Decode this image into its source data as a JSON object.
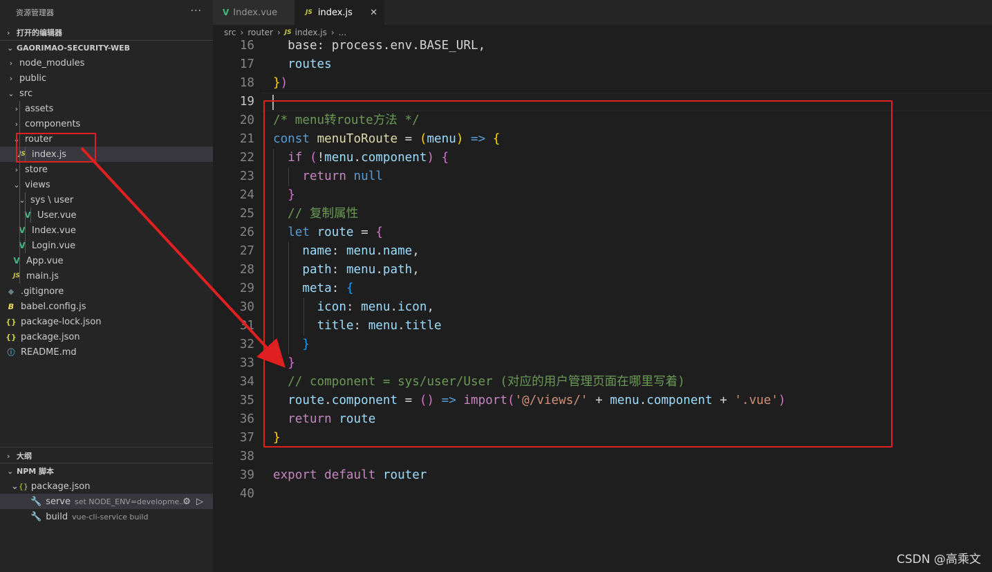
{
  "explorer": {
    "title": "资源管理器",
    "more_label": "···",
    "open_editors": "打开的编辑器",
    "project": "GAORIMAO-SECURITY-WEB",
    "tree": [
      {
        "label": "node_modules",
        "depth": 0,
        "type": "folder",
        "open": false,
        "icon": "chevron-right-icon"
      },
      {
        "label": "public",
        "depth": 0,
        "type": "folder",
        "open": false,
        "icon": "chevron-right-icon"
      },
      {
        "label": "src",
        "depth": 0,
        "type": "folder",
        "open": true,
        "icon": "chevron-down-icon"
      },
      {
        "label": "assets",
        "depth": 1,
        "type": "folder",
        "open": false,
        "icon": "chevron-right-icon"
      },
      {
        "label": "components",
        "depth": 1,
        "type": "folder",
        "open": false,
        "icon": "chevron-right-icon"
      },
      {
        "label": "router",
        "depth": 1,
        "type": "folder",
        "open": true,
        "icon": "chevron-down-icon"
      },
      {
        "label": "index.js",
        "depth": 2,
        "type": "js",
        "selected": true,
        "icon": "js-file-icon"
      },
      {
        "label": "store",
        "depth": 1,
        "type": "folder",
        "open": false,
        "icon": "chevron-right-icon"
      },
      {
        "label": "views",
        "depth": 1,
        "type": "folder",
        "open": true,
        "icon": "chevron-down-icon"
      },
      {
        "label": "sys \\ user",
        "depth": 2,
        "type": "folder",
        "open": true,
        "icon": "chevron-down-icon"
      },
      {
        "label": "User.vue",
        "depth": 3,
        "type": "vue",
        "icon": "vue-file-icon"
      },
      {
        "label": "Index.vue",
        "depth": 2,
        "type": "vue",
        "icon": "vue-file-icon"
      },
      {
        "label": "Login.vue",
        "depth": 2,
        "type": "vue",
        "icon": "vue-file-icon"
      },
      {
        "label": "App.vue",
        "depth": 1,
        "type": "vue",
        "icon": "vue-file-icon"
      },
      {
        "label": "main.js",
        "depth": 1,
        "type": "js",
        "icon": "js-file-icon"
      },
      {
        "label": ".gitignore",
        "depth": 0,
        "type": "git",
        "icon": "git-file-icon"
      },
      {
        "label": "babel.config.js",
        "depth": 0,
        "type": "babel",
        "icon": "babel-file-icon"
      },
      {
        "label": "package-lock.json",
        "depth": 0,
        "type": "json",
        "icon": "json-file-icon"
      },
      {
        "label": "package.json",
        "depth": 0,
        "type": "json",
        "icon": "json-file-icon"
      },
      {
        "label": "README.md",
        "depth": 0,
        "type": "info",
        "icon": "info-file-icon"
      }
    ],
    "outline": "大纲",
    "npm_scripts": "NPM 脚本",
    "npm_package": "package.json",
    "scripts": [
      {
        "name": "serve",
        "cmd": "set NODE_ENV=developme...",
        "selected": true
      },
      {
        "name": "build",
        "cmd": "vue-cli-service build",
        "selected": false
      }
    ]
  },
  "tabs": [
    {
      "label": "Index.vue",
      "icon": "vue-file-icon",
      "active": false
    },
    {
      "label": "index.js",
      "icon": "js-file-icon",
      "active": true,
      "close": "✕"
    }
  ],
  "breadcrumb": [
    "src",
    "router",
    "index.js",
    "..."
  ],
  "icons": {
    "js": "JS",
    "vue": "V",
    "json": "{}",
    "babel": "B",
    "git": "◆",
    "info": "ⓘ",
    "chev_right": "›",
    "chev_down": "⌄"
  },
  "colors": {
    "highlight_box": "#e02020",
    "background": "#1e1e1e",
    "sidebar": "#252526"
  },
  "editor": {
    "current_line": 19,
    "lines": [
      {
        "n": "16",
        "t": [
          [
            "  base: process.env.BASE_URL,",
            "c-p"
          ]
        ]
      },
      {
        "n": "17",
        "t": [
          [
            "  ",
            "c-p"
          ],
          [
            "routes",
            "c-var"
          ]
        ]
      },
      {
        "n": "18",
        "t": [
          [
            "}",
            "c-b1"
          ],
          [
            ")",
            "c-b2"
          ]
        ]
      },
      {
        "n": "19",
        "t": []
      },
      {
        "n": "20",
        "t": [
          [
            "/* menu转route方法 */",
            "c-com"
          ]
        ]
      },
      {
        "n": "21",
        "t": [
          [
            "const ",
            "c-kw"
          ],
          [
            "menuToRoute",
            "c-fn"
          ],
          [
            " = ",
            "c-p"
          ],
          [
            "(",
            "c-b1"
          ],
          [
            "menu",
            "c-var"
          ],
          [
            ")",
            "c-b1"
          ],
          [
            " => ",
            "c-kw"
          ],
          [
            "{",
            "c-b1"
          ]
        ]
      },
      {
        "n": "22",
        "t": [
          [
            "  ",
            "c-p"
          ],
          [
            "if",
            "c-ctl"
          ],
          [
            " ",
            "c-p"
          ],
          [
            "(",
            "c-b2"
          ],
          [
            "!",
            "c-p"
          ],
          [
            "menu",
            "c-var"
          ],
          [
            ".",
            "c-p"
          ],
          [
            "component",
            "c-var"
          ],
          [
            ")",
            "c-b2"
          ],
          [
            " ",
            "c-p"
          ],
          [
            "{",
            "c-b2"
          ]
        ]
      },
      {
        "n": "23",
        "t": [
          [
            "    ",
            "c-p"
          ],
          [
            "return",
            "c-ctl"
          ],
          [
            " ",
            "c-p"
          ],
          [
            "null",
            "c-kw"
          ]
        ]
      },
      {
        "n": "24",
        "t": [
          [
            "  ",
            "c-p"
          ],
          [
            "}",
            "c-b2"
          ]
        ]
      },
      {
        "n": "25",
        "t": [
          [
            "  // 复制属性",
            "c-com"
          ]
        ]
      },
      {
        "n": "26",
        "t": [
          [
            "  ",
            "c-p"
          ],
          [
            "let",
            "c-kw"
          ],
          [
            " ",
            "c-p"
          ],
          [
            "route",
            "c-var"
          ],
          [
            " = ",
            "c-p"
          ],
          [
            "{",
            "c-b2"
          ]
        ]
      },
      {
        "n": "27",
        "t": [
          [
            "    ",
            "c-p"
          ],
          [
            "name",
            "c-var"
          ],
          [
            ": ",
            "c-p"
          ],
          [
            "menu",
            "c-var"
          ],
          [
            ".",
            "c-p"
          ],
          [
            "name",
            "c-var"
          ],
          [
            ",",
            "c-p"
          ]
        ]
      },
      {
        "n": "28",
        "t": [
          [
            "    ",
            "c-p"
          ],
          [
            "path",
            "c-var"
          ],
          [
            ": ",
            "c-p"
          ],
          [
            "menu",
            "c-var"
          ],
          [
            ".",
            "c-p"
          ],
          [
            "path",
            "c-var"
          ],
          [
            ",",
            "c-p"
          ]
        ]
      },
      {
        "n": "29",
        "t": [
          [
            "    ",
            "c-p"
          ],
          [
            "meta",
            "c-var"
          ],
          [
            ": ",
            "c-p"
          ],
          [
            "{",
            "c-b3"
          ]
        ]
      },
      {
        "n": "30",
        "t": [
          [
            "      ",
            "c-p"
          ],
          [
            "icon",
            "c-var"
          ],
          [
            ": ",
            "c-p"
          ],
          [
            "menu",
            "c-var"
          ],
          [
            ".",
            "c-p"
          ],
          [
            "icon",
            "c-var"
          ],
          [
            ",",
            "c-p"
          ]
        ]
      },
      {
        "n": "31",
        "t": [
          [
            "      ",
            "c-p"
          ],
          [
            "title",
            "c-var"
          ],
          [
            ": ",
            "c-p"
          ],
          [
            "menu",
            "c-var"
          ],
          [
            ".",
            "c-p"
          ],
          [
            "title",
            "c-var"
          ]
        ]
      },
      {
        "n": "32",
        "t": [
          [
            "    ",
            "c-p"
          ],
          [
            "}",
            "c-b3"
          ]
        ]
      },
      {
        "n": "33",
        "t": [
          [
            "  ",
            "c-p"
          ],
          [
            "}",
            "c-b2"
          ]
        ]
      },
      {
        "n": "34",
        "t": [
          [
            "  // component = sys/user/User (对应的用户管理页面在哪里写着)",
            "c-com"
          ]
        ]
      },
      {
        "n": "35",
        "t": [
          [
            "  ",
            "c-p"
          ],
          [
            "route",
            "c-var"
          ],
          [
            ".",
            "c-p"
          ],
          [
            "component",
            "c-var"
          ],
          [
            " = ",
            "c-p"
          ],
          [
            "()",
            "c-b2"
          ],
          [
            " => ",
            "c-kw"
          ],
          [
            "import",
            "c-ctl"
          ],
          [
            "(",
            "c-b2"
          ],
          [
            "'@/views/'",
            "c-str"
          ],
          [
            " + ",
            "c-p"
          ],
          [
            "menu",
            "c-var"
          ],
          [
            ".",
            "c-p"
          ],
          [
            "component",
            "c-var"
          ],
          [
            " + ",
            "c-p"
          ],
          [
            "'.vue'",
            "c-str"
          ],
          [
            ")",
            "c-b2"
          ]
        ]
      },
      {
        "n": "36",
        "t": [
          [
            "  ",
            "c-p"
          ],
          [
            "return",
            "c-ctl"
          ],
          [
            " ",
            "c-p"
          ],
          [
            "route",
            "c-var"
          ]
        ]
      },
      {
        "n": "37",
        "t": [
          [
            "}",
            "c-b1"
          ]
        ]
      },
      {
        "n": "38",
        "t": []
      },
      {
        "n": "39",
        "t": [
          [
            "export",
            "c-ctl"
          ],
          [
            " ",
            "c-p"
          ],
          [
            "default",
            "c-ctl"
          ],
          [
            " ",
            "c-p"
          ],
          [
            "router",
            "c-var"
          ]
        ]
      },
      {
        "n": "40",
        "t": []
      }
    ]
  },
  "watermark": "CSDN @高乘文"
}
